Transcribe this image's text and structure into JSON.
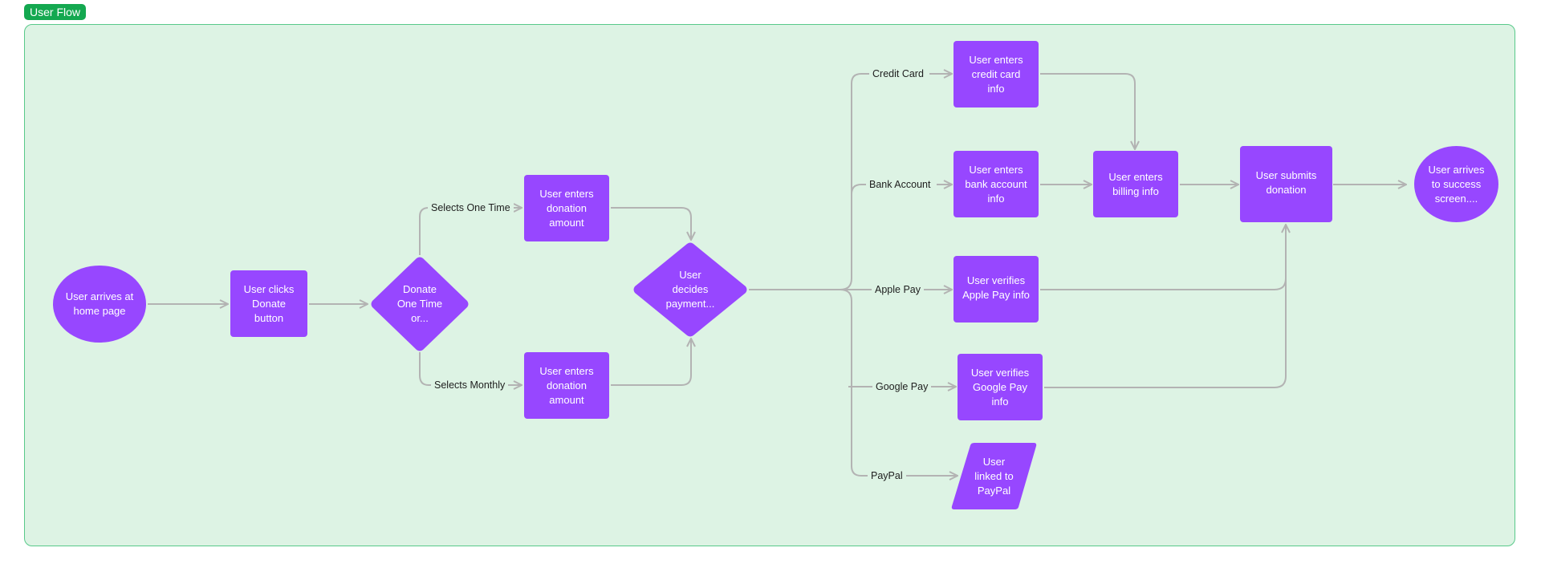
{
  "section": {
    "label": "User Flow"
  },
  "colors": {
    "node_fill": "#9747ff",
    "frame_fill": "#ddf3e4",
    "frame_border": "#58c98a",
    "label_badge": "#14a850",
    "connector": "#b3b3b3"
  },
  "nodes": {
    "start": "User arrives at\nhome page",
    "click_donate": "User clicks\nDonate\nbutton",
    "decide_frequency": "Donate\nOne Time\nor...",
    "amount_one_time": "User enters\ndonation\namount",
    "amount_monthly": "User enters\ndonation\namount",
    "decide_payment": "User\ndecides\npayment...",
    "credit_card": "User enters\ncredit card\ninfo",
    "bank_account": "User enters\nbank account\ninfo",
    "apple_pay": "User verifies\nApple Pay info",
    "google_pay": "User verifies\nGoogle Pay\ninfo",
    "paypal": "User\nlinked to\nPayPal",
    "billing": "User enters\nbilling info",
    "submit": "User submits\ndonation",
    "success": "User arrives\nto success\nscreen...."
  },
  "edge_labels": {
    "one_time": "Selects One Time",
    "monthly": "Selects Monthly",
    "credit_card": "Credit Card",
    "bank_account": "Bank Account",
    "apple_pay": "Apple Pay",
    "google_pay": "Google Pay",
    "paypal": "PayPal"
  }
}
